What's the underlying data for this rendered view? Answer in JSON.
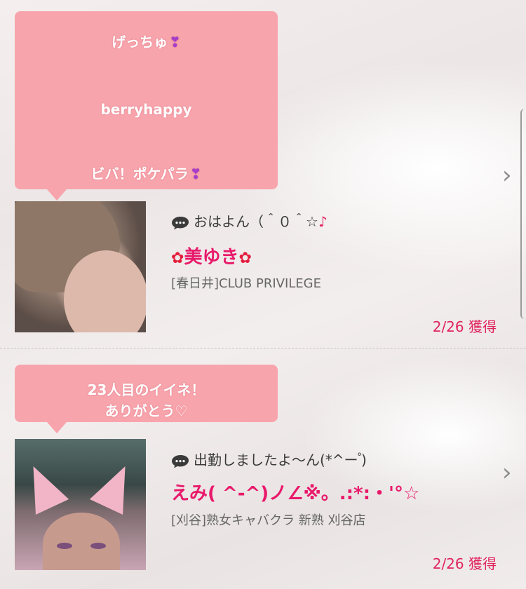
{
  "cards": [
    {
      "bubble_lines": [
        "げっちゅ",
        "berryhappy",
        "ビバ！ポケパラ"
      ],
      "bubble_hearts": [
        "❣",
        "",
        "❣"
      ],
      "message": "おはよん（＾０＾☆",
      "message_note": "♪",
      "name": "美ゆき",
      "name_flower_left": "✿",
      "name_flower_right": "✿",
      "shop": "[春日井]CLUB PRIVILEGE",
      "date": "2/26 獲得",
      "chevron": "›"
    },
    {
      "bubble_lines": [
        "23人目のイイネ！",
        "ありがとう♡"
      ],
      "message": "出勤しましたよ〜ん(*^ー ゚)",
      "name": "えみ( ^-^)ノ∠※。.:*:・'°☆",
      "shop": "[刈谷]熟女キャバクラ 新熟 刈谷店",
      "date": "2/26 獲得",
      "chevron": "›"
    }
  ],
  "icons": {
    "message": "speech-bubble-icon",
    "detail": "chevron-right-icon"
  },
  "colors": {
    "bubble": "#f8a4ac",
    "name": "#e8196a",
    "date": "#e0245e"
  }
}
